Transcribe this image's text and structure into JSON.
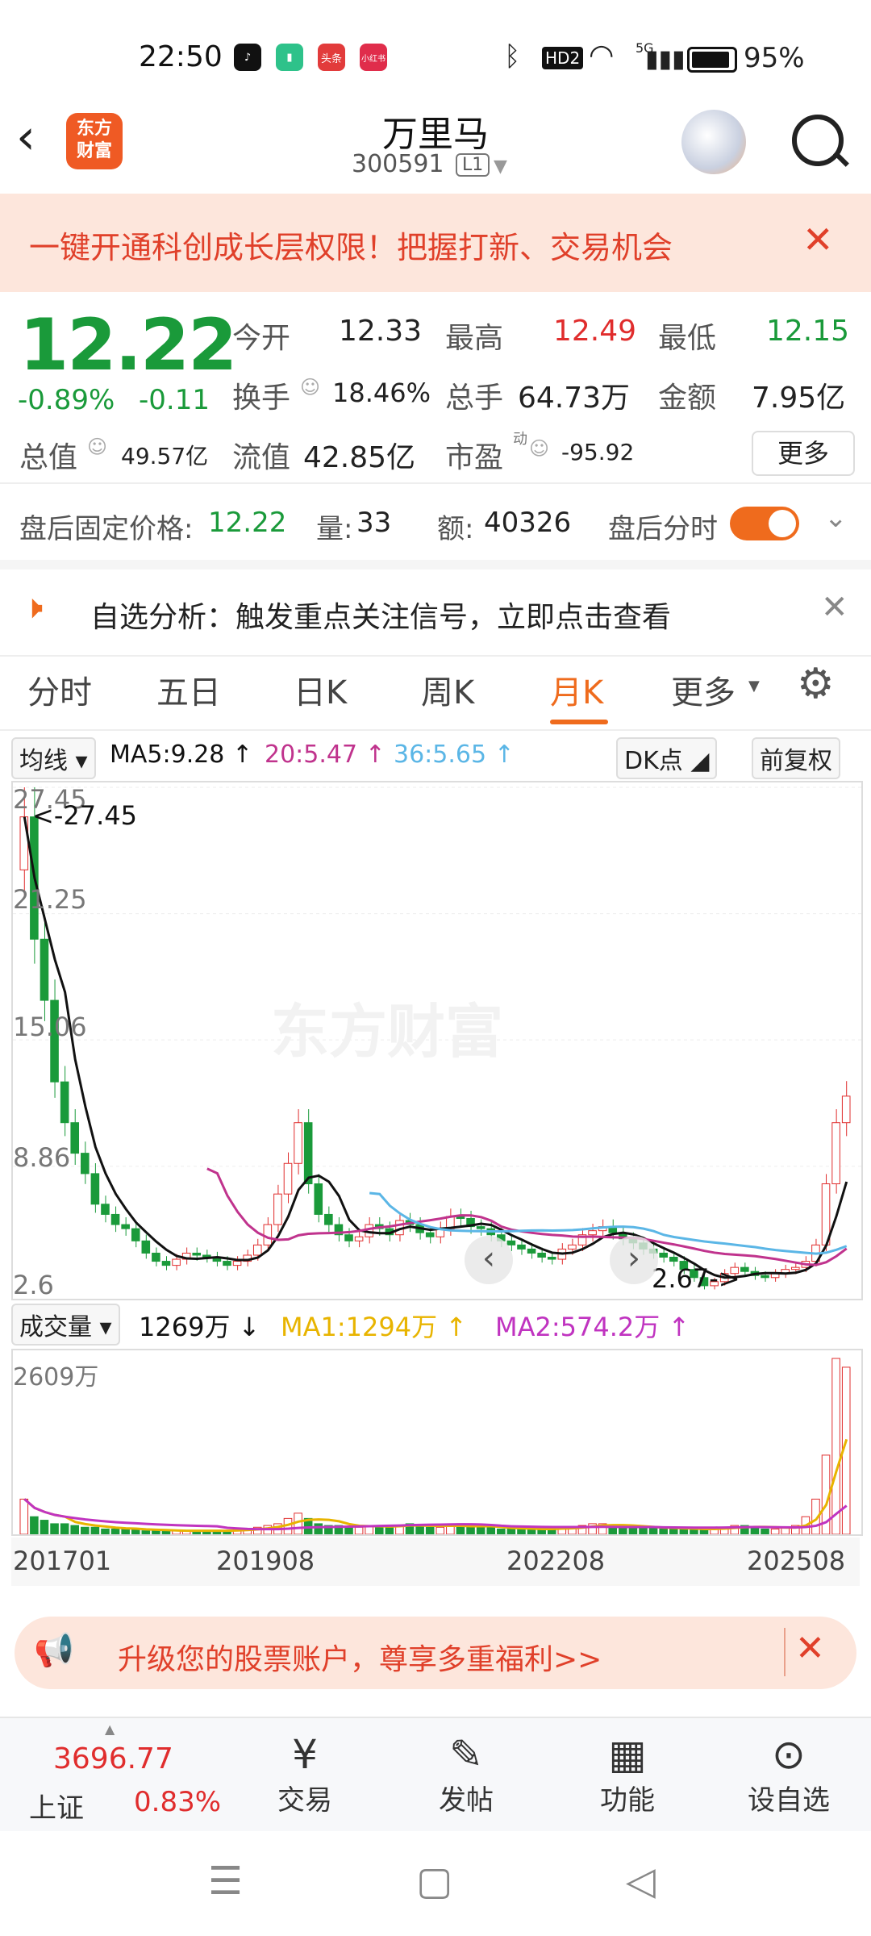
{
  "status_bar": {
    "time": "22:50",
    "battery": "95%",
    "network": "5G",
    "hd": "HD2",
    "app_icons": [
      "头条",
      "小红书"
    ]
  },
  "header": {
    "logo_line1": "东方",
    "logo_line2": "财富",
    "title": "万里马",
    "code": "300591",
    "level": "L1"
  },
  "banner": {
    "text": "一键开通科创成长层权限！把握打新、交易机会"
  },
  "quote": {
    "price": "12.22",
    "change_pct": "-0.89%",
    "change": "-0.11",
    "open_label": "今开",
    "open": "12.33",
    "high_label": "最高",
    "high": "12.49",
    "low_label": "最低",
    "low": "12.15",
    "turnover_label": "换手",
    "turnover": "18.46%",
    "volume_label": "总手",
    "volume": "64.73万",
    "amount_label": "金额",
    "amount": "7.95亿",
    "mktcap_label": "总值",
    "mktcap": "49.57亿",
    "float_label": "流值",
    "float_cap": "42.85亿",
    "pe_label": "市盈",
    "pe_sup": "动",
    "pe": "-95.92",
    "more_label": "更多"
  },
  "after_hours": {
    "price_label": "盘后固定价格:",
    "price": "12.22",
    "vol_label": "量:",
    "vol": "33",
    "amt_label": "额:",
    "amt": "40326",
    "toggle_label": "盘后分时",
    "toggle_on": true
  },
  "analysis": {
    "text": "自选分析：触发重点关注信号，立即点击查看"
  },
  "tabs": [
    {
      "label": "分时"
    },
    {
      "label": "五日"
    },
    {
      "label": "日K"
    },
    {
      "label": "周K"
    },
    {
      "label": "月K",
      "active": true
    },
    {
      "label": "更多"
    }
  ],
  "kline_header": {
    "type": "均线",
    "ma5": "MA5:9.28",
    "ma20": "20:5.47",
    "ma36": "36:5.65",
    "dk": "DK点",
    "adjust": "前复权"
  },
  "kline_axis": {
    "y_ticks": [
      "27.45",
      "21.25",
      "15.06",
      "8.86",
      "2.6"
    ],
    "max_note": "<-27.45",
    "min_note": "2.67->"
  },
  "vol_header": {
    "type": "成交量",
    "value": "1269万",
    "ma1": "MA1:1294万",
    "ma2": "MA2:574.2万"
  },
  "vol_axis": {
    "max": "2609万"
  },
  "x_dates": [
    "201701",
    "201908",
    "202208",
    "202508"
  ],
  "watermark": "东方财富",
  "promo": {
    "text": "升级您的股票账户，尊享多重福利>>"
  },
  "bottom_nav": {
    "index_value": "3696.77",
    "index_name": "上证",
    "index_change": "0.83%",
    "items": [
      {
        "label": "交易"
      },
      {
        "label": "发帖"
      },
      {
        "label": "功能"
      },
      {
        "label": "设自选"
      }
    ]
  },
  "colors": {
    "up": "#e02d2d",
    "down": "#1a9a3a",
    "accent": "#ef6b1d",
    "ma5": "#111111",
    "ma20": "#c0338d",
    "ma36": "#5bb6e6",
    "ma1": "#e8b400",
    "ma2": "#c034c0"
  },
  "chart_data": [
    {
      "type": "candlestick",
      "title": "月K",
      "x_range": [
        "201701",
        "202508"
      ],
      "ylim": [
        2.6,
        27.45
      ],
      "series": [
        {
          "name": "MA5",
          "last": 9.28
        },
        {
          "name": "MA20",
          "last": 5.47
        },
        {
          "name": "MA36",
          "last": 5.65
        }
      ],
      "y_ticks": [
        27.45,
        21.25,
        15.06,
        8.86,
        2.6
      ],
      "high": 27.45,
      "low": 2.67
    },
    {
      "type": "bar",
      "title": "成交量",
      "ymax": "2609万",
      "series": [
        {
          "name": "MA1",
          "last": "1294万"
        },
        {
          "name": "MA2",
          "last": "574.2万"
        }
      ],
      "last": "1269万"
    }
  ]
}
